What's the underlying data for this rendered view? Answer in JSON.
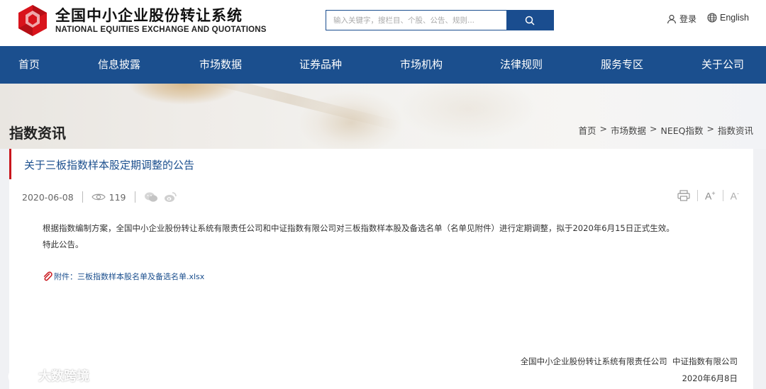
{
  "header": {
    "logo_cn": "全国中小企业股份转让系统",
    "logo_en": "NATIONAL EQUITIES EXCHANGE AND QUOTATIONS",
    "search_placeholder": "输入关键字，搜栏目、个股、公告、规则...",
    "login_label": "登录",
    "lang_label": "English"
  },
  "nav": {
    "items": [
      "首页",
      "信息披露",
      "市场数据",
      "证券品种",
      "市场机构",
      "法律规则",
      "服务专区",
      "关于公司"
    ]
  },
  "banner": {
    "page_title": "指数资讯",
    "breadcrumb": [
      "首页",
      "市场数据",
      "NEEQ指数",
      "指数资讯"
    ],
    "breadcrumb_sep": ">"
  },
  "article": {
    "title": "关于三板指数样本股定期调整的公告",
    "date": "2020-06-08",
    "views": "119",
    "font_up_label": "A",
    "font_down_label": "A",
    "font_up_sup": "+",
    "font_down_sup": "-",
    "paragraphs": [
      "根据指数编制方案，全国中小企业股份转让系统有限责任公司和中证指数有限公司对三板指数样本股及备选名单（名单见附件）进行定期调整，拟于2020年6月15日正式生效。",
      "特此公告。"
    ],
    "attachment_label": "附件：三板指数样本股名单及备选名单.xlsx",
    "signature": "全国中小企业股份转让系统有限责任公司  中证指数有限公司",
    "sign_date": "2020年6月8日"
  },
  "watermark": {
    "text": "大数跨境"
  },
  "colors": {
    "brand_blue": "#1b4f8e",
    "accent_red": "#c9161d"
  }
}
